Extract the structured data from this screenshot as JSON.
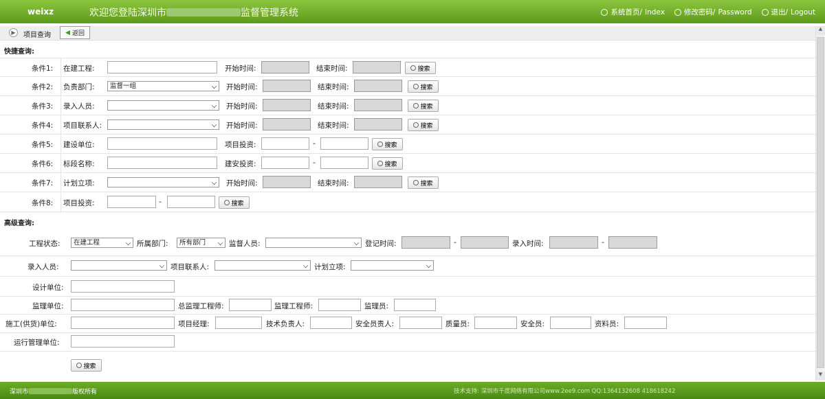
{
  "header": {
    "logo": "weixz",
    "welcome_prefix": "欢迎您登陆深圳市",
    "welcome_suffix": "监督管理系统",
    "links": [
      {
        "label": "系统首页/",
        "sub": "Index",
        "icon": "ie-icon"
      },
      {
        "label": "修改密码/",
        "sub": "Password",
        "icon": "gear-icon"
      },
      {
        "label": "退出/",
        "sub": "Logout",
        "icon": "power-icon"
      }
    ]
  },
  "toolbar": {
    "title": "项目查询",
    "back_label": "返回"
  },
  "quick": {
    "title": "快捷查询:",
    "search_label": "搜索",
    "rows": [
      {
        "cond": "条件1:",
        "field": "在建工程:",
        "type": "text",
        "mid": "开始时间:",
        "end": "结束时间:"
      },
      {
        "cond": "条件2:",
        "field": "负责部门:",
        "type": "select",
        "value": "监督一组",
        "mid": "开始时间:",
        "end": "结束时间:"
      },
      {
        "cond": "条件3:",
        "field": "录入人员:",
        "type": "select",
        "value": "",
        "mid": "开始时间:",
        "end": "结束时间:"
      },
      {
        "cond": "条件4:",
        "field": "项目联系人:",
        "type": "select",
        "value": "",
        "mid": "开始时间:",
        "end": "结束时间:"
      },
      {
        "cond": "条件5:",
        "field": "建设单位:",
        "type": "text",
        "mid": "项目投资:",
        "end": "-"
      },
      {
        "cond": "条件6:",
        "field": "标段名称:",
        "type": "text",
        "mid": "建安投资:",
        "end": "-"
      },
      {
        "cond": "条件7:",
        "field": "计划立项:",
        "type": "select",
        "value": "",
        "mid": "开始时间:",
        "end": "结束时间:"
      },
      {
        "cond": "条件8:",
        "field": "项目投资:",
        "type": "range"
      }
    ]
  },
  "advanced": {
    "title": "高级查询:",
    "status_label": "工程状态:",
    "status_value": "在建工程",
    "dept_label": "所属部门:",
    "dept_value": "所有部门",
    "supervisor_label": "监督人员:",
    "reg_time_label": "登记时间:",
    "entry_time_label": "录入时间:",
    "entry_person_label": "录入人员:",
    "contact_label": "项目联系人:",
    "plan_label": "计划立项:",
    "design_label": "设计单位:",
    "supervision_unit_label": "监理单位:",
    "chief_engineer_label": "总监理工程师:",
    "engineer_label": "监理工程师:",
    "supervisor_staff_label": "监理员:",
    "construction_label": "施工(供货)单位:",
    "pm_label": "项目经理:",
    "tech_label": "技术负责人:",
    "safety_head_label": "安全员责人:",
    "quality_label": "质量员:",
    "safety_label": "安全员:",
    "data_label": "资料员:",
    "ops_label": "运行管理单位:",
    "search_label": "搜索"
  },
  "footer": {
    "copy_prefix": "深圳市",
    "copy_suffix": "版权所有",
    "tech": "技术支持: 深圳市千度网络有限公司www.2ee9.com  QQ:1364132608 418618242"
  },
  "colors": {
    "header": "#6aa82a",
    "footer": "#58981c"
  }
}
